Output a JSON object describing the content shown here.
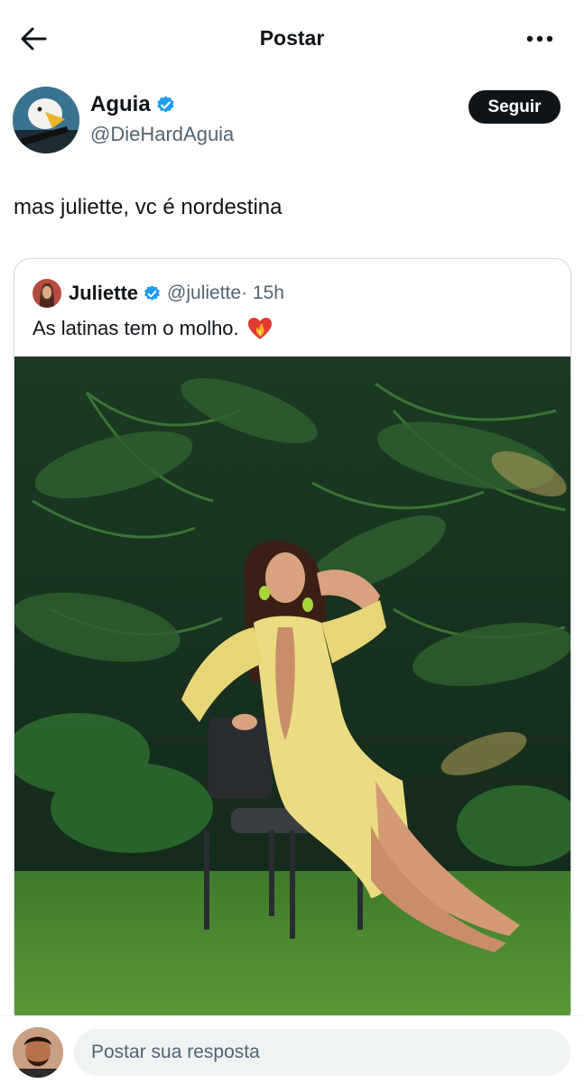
{
  "header": {
    "title": "Postar"
  },
  "author": {
    "name": "Aguia",
    "handle": "@DieHardAguia",
    "follow_label": "Seguir"
  },
  "post": {
    "text": "mas juliette, vc é nordestina"
  },
  "quoted": {
    "name": "Juliette",
    "handle": "@juliette",
    "time": "· 15h",
    "text": "As latinas tem o molho.",
    "photo_icon": "photo-woman-yellow-dress-garden"
  },
  "reply": {
    "placeholder": "Postar sua resposta"
  },
  "colors": {
    "text": "#0f1419",
    "muted": "#536471",
    "verified": "#1d9bf0",
    "border": "#cfd9de",
    "input_bg": "#eff3f4"
  },
  "icons": [
    "back-arrow-icon",
    "more-icon",
    "verified-icon",
    "fire-heart-icon"
  ]
}
